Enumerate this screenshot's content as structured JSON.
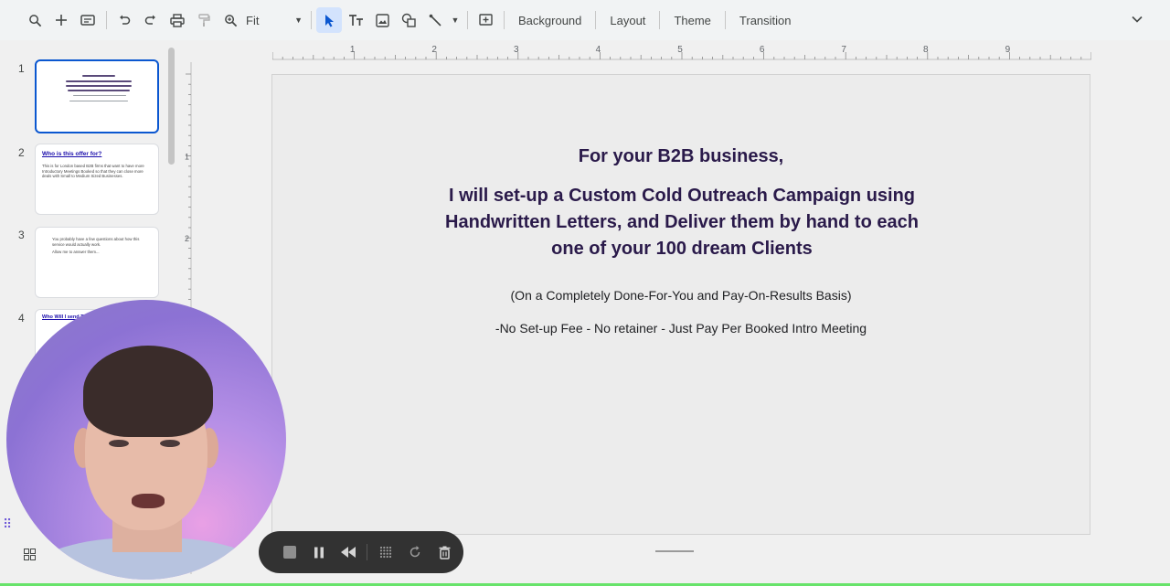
{
  "toolbar": {
    "zoom_value": "Fit",
    "background_label": "Background",
    "layout_label": "Layout",
    "theme_label": "Theme",
    "transition_label": "Transition",
    "icons": [
      "search-icon",
      "add-icon",
      "new-slide-icon",
      "undo-icon",
      "redo-icon",
      "print-icon",
      "paint-format-icon",
      "zoom-icon",
      "select-icon",
      "text-box-icon",
      "image-icon",
      "shape-icon",
      "line-icon",
      "comment-icon",
      "collapse-icon"
    ]
  },
  "filmstrip": {
    "slides": [
      {
        "number": "1"
      },
      {
        "number": "2",
        "title": "Who is this offer for?",
        "text": "This is for London based B2B firms that want to have more Introductory Meetings Booked so that they can close more deals with Small to Medium Sized Businesses."
      },
      {
        "number": "3",
        "text": "You probably have a few questions about how this service would actually work.",
        "text2": "Allow me to answer them..."
      },
      {
        "number": "4",
        "title": "Who Will I send T..."
      }
    ]
  },
  "ruler": {
    "h_labels": [
      "1",
      "2",
      "3",
      "4",
      "5",
      "6",
      "7",
      "8",
      "9"
    ],
    "v_labels": [
      "1",
      "2"
    ]
  },
  "slide": {
    "heading": "For your B2B business,",
    "lead": "I will set-up a Custom Cold Outreach Campaign using Handwritten Letters, and Deliver them by hand to each one of your 100 dream Clients",
    "basis": "(On a Completely Done-For-You and Pay-On-Results Basis)",
    "terms": "-No Set-up Fee  - No retainer  - Just Pay Per Booked Intro Meeting"
  },
  "colors": {
    "slide_text": "#2a1a4a",
    "selected_border": "#0b57d0",
    "recorder_bg": "#323232",
    "accent_line": "#67e36a"
  }
}
